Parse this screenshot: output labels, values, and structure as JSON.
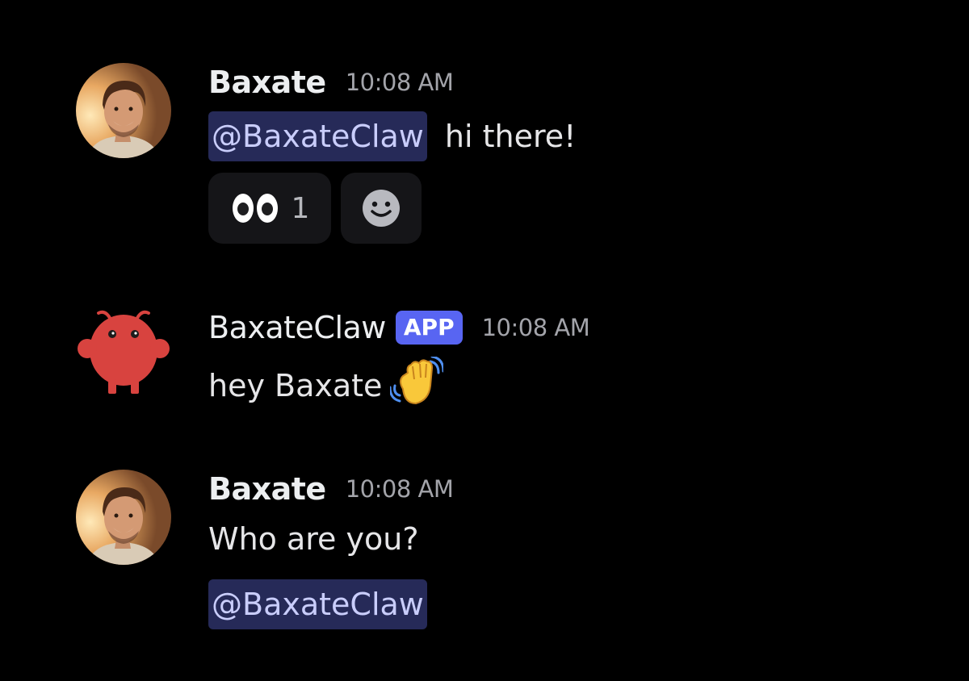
{
  "messages": [
    {
      "author": "Baxate",
      "timestamp": "10:08 AM",
      "mention": "@BaxateClaw",
      "text": "hi there!",
      "reactions": [
        {
          "emoji": "eyes-emoji",
          "count": "1"
        }
      ]
    },
    {
      "author": "BaxateClaw",
      "badge": "APP",
      "timestamp": "10:08 AM",
      "text": "hey Baxate",
      "emoji": "waving-hand-emoji"
    },
    {
      "author": "Baxate",
      "timestamp": "10:08 AM",
      "text": "Who are you?",
      "mention": "@BaxateClaw"
    }
  ],
  "colors": {
    "background": "#000000",
    "mention_bg": "#262a58",
    "mention_text": "#c9cdfb",
    "app_badge": "#5865f2",
    "timestamp": "#a3a4aa",
    "reaction_bg": "#151518",
    "bot_avatar": "#d8433f"
  },
  "icons": {
    "add_reaction": "smiley-face-icon"
  }
}
